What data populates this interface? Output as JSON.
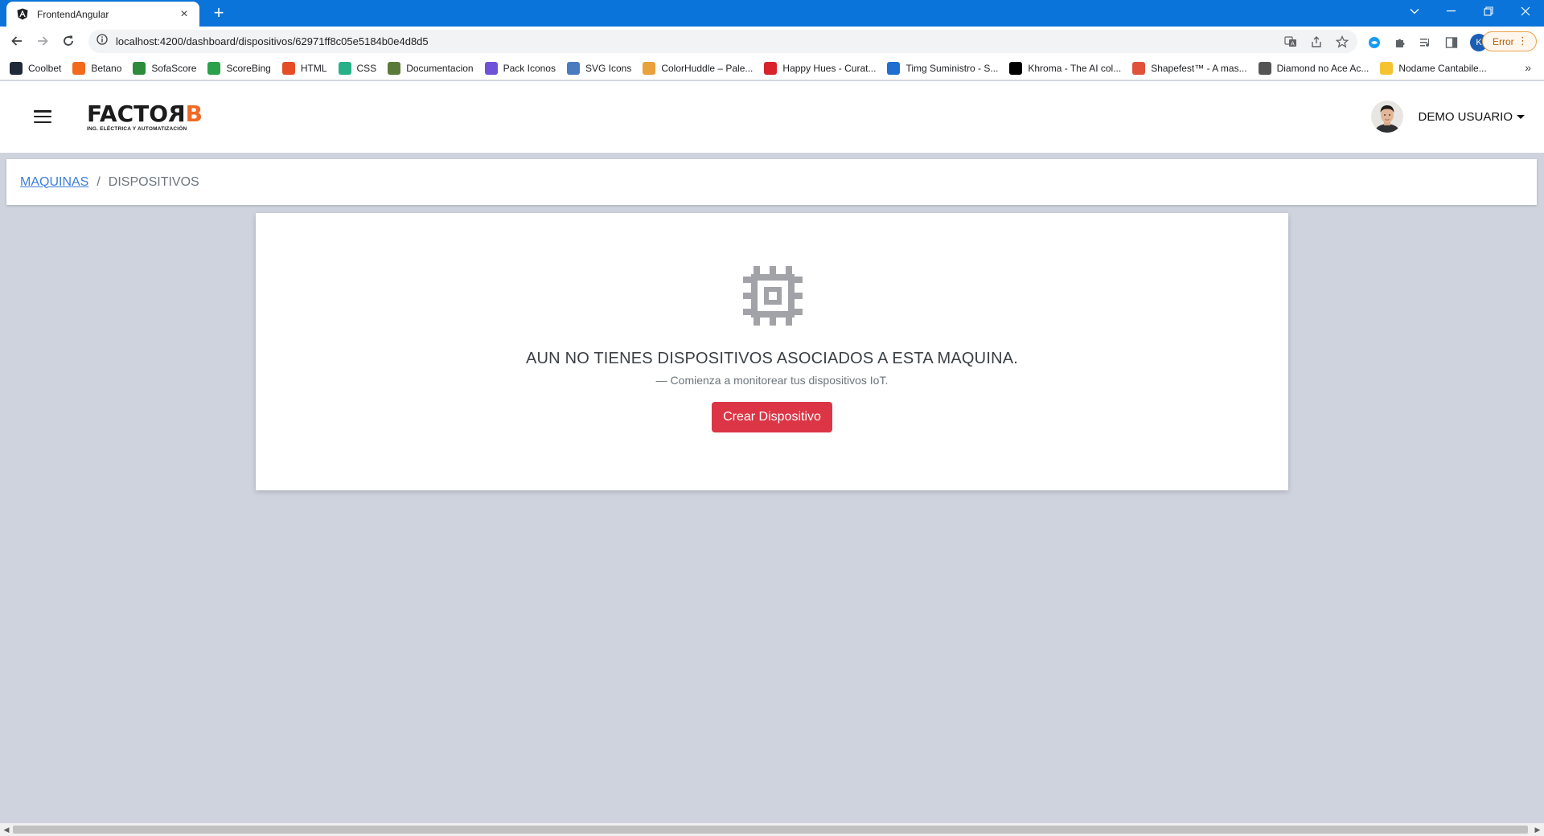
{
  "browser": {
    "tab_title": "FrontendAngular",
    "url": "localhost:4200/dashboard/dispositivos/62971ff8c05e5184b0e4d8d5",
    "profile_initial": "K",
    "error_label": "Error",
    "bookmarks": [
      {
        "label": "Coolbet",
        "color": "#1f2a38"
      },
      {
        "label": "Betano",
        "color": "#f26b1d"
      },
      {
        "label": "SofaScore",
        "color": "#2c8c3c"
      },
      {
        "label": "ScoreBing",
        "color": "#2aa14a"
      },
      {
        "label": "HTML",
        "color": "#e44d26"
      },
      {
        "label": "CSS",
        "color": "#28b089"
      },
      {
        "label": "Documentacion",
        "color": "#5a7a3a"
      },
      {
        "label": "Pack Iconos",
        "color": "#6f52d8"
      },
      {
        "label": "SVG Icons",
        "color": "#4a7bbf"
      },
      {
        "label": "ColorHuddle – Pale...",
        "color": "#e9a23b"
      },
      {
        "label": "Happy Hues - Curat...",
        "color": "#d8232a"
      },
      {
        "label": "Timg Suministro - S...",
        "color": "#1f6fd1"
      },
      {
        "label": "Khroma - The AI col...",
        "color": "#000000"
      },
      {
        "label": "Shapefest™ - A mas...",
        "color": "#e0533a"
      },
      {
        "label": "Diamond no Ace Ac...",
        "color": "#555555"
      },
      {
        "label": "Nodame Cantabile...",
        "color": "#f4c430"
      }
    ],
    "bookmarks_more": "»",
    "tab_close": "×",
    "new_tab": "+"
  },
  "header": {
    "logo_main_left": "FACTO",
    "logo_main_r": "R",
    "logo_main_b": "B",
    "logo_sub": "ING. ELÉCTRICA Y AUTOMATIZACIÓN",
    "user_name": "DEMO USUARIO"
  },
  "breadcrumb": {
    "link": "MAQUINAS",
    "separator": "/",
    "current": "DISPOSITIVOS"
  },
  "empty_state": {
    "icon": "chip-icon",
    "title": "AUN NO TIENES DISPOSITIVOS ASOCIADOS A ESTA MAQUINA.",
    "subtitle": "— Comienza a monitorear tus dispositivos IoT.",
    "button_label": "Crear Dispositivo"
  },
  "colors": {
    "tabbar": "#0a74da",
    "page_bg": "#cfd3de",
    "danger": "#dc3545",
    "link": "#3b7ddd",
    "logo_accent": "#f06a24"
  }
}
